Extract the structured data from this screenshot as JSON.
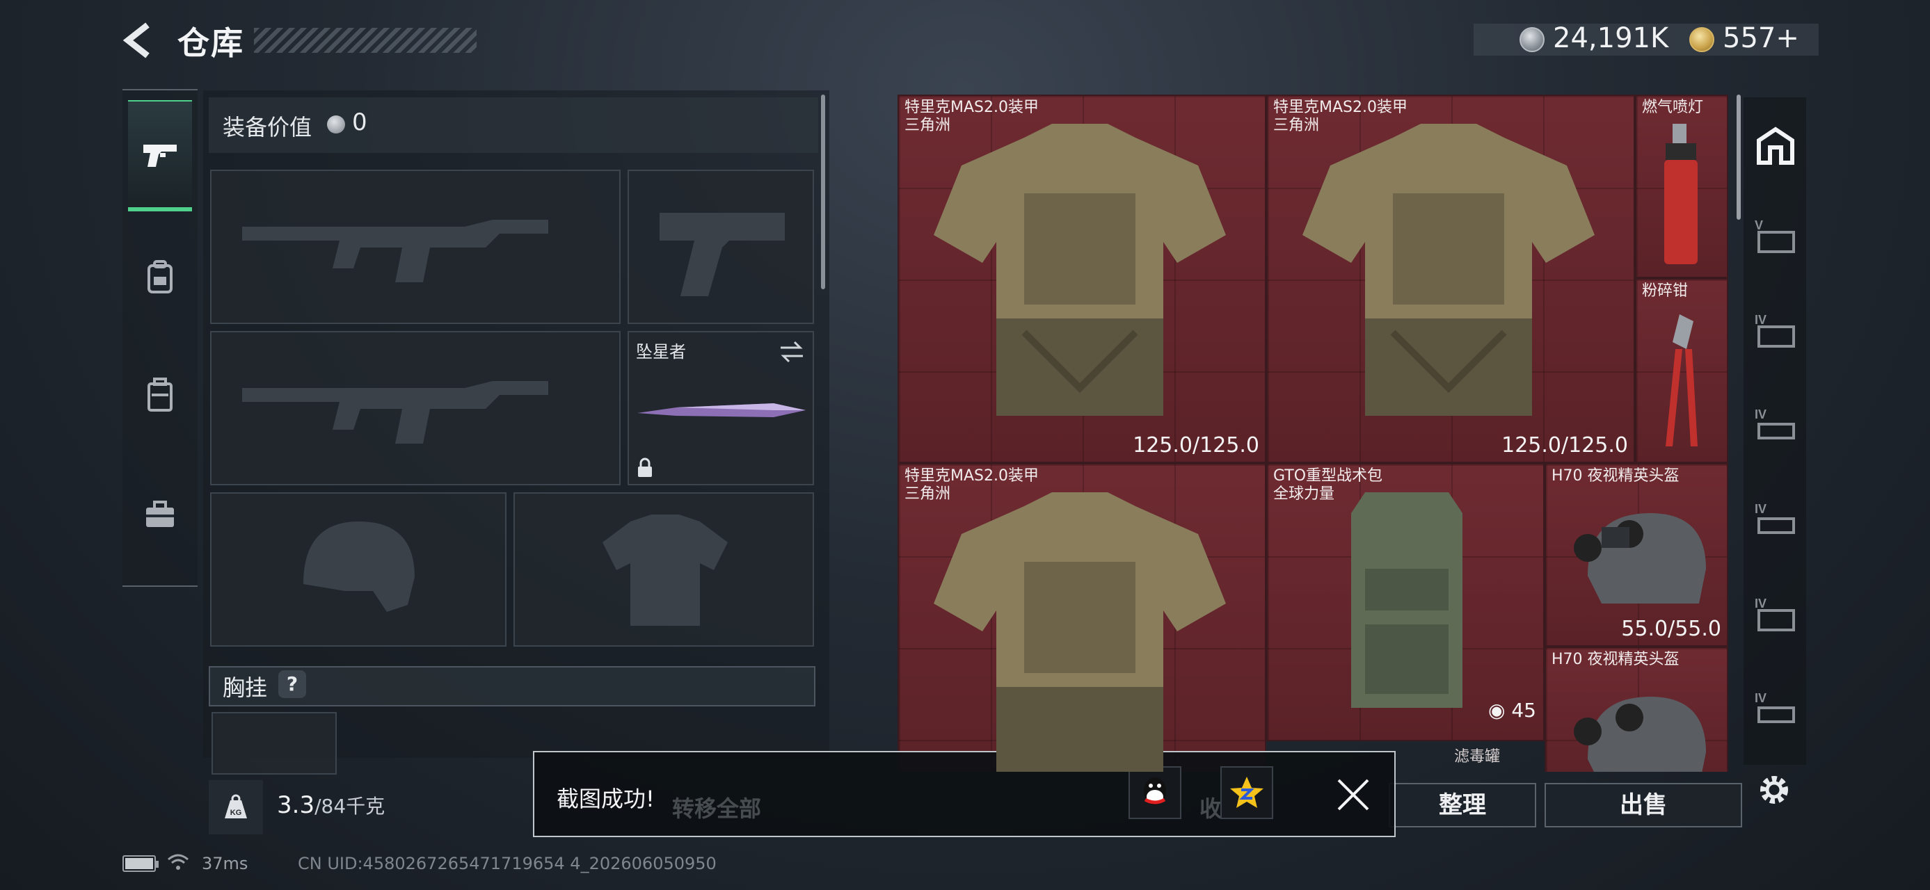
{
  "header": {
    "title": "仓库",
    "silver_value": "24,191K",
    "gold_value": "557",
    "gold_plus": "+"
  },
  "left_nav": {
    "items": [
      {
        "name": "weapons",
        "icon": "pistol-icon",
        "active": true
      },
      {
        "name": "equipment",
        "icon": "backpack-icon",
        "active": false
      },
      {
        "name": "gear",
        "icon": "case-icon",
        "active": false
      },
      {
        "name": "tools",
        "icon": "toolbox-icon",
        "active": false
      }
    ]
  },
  "loadout": {
    "equip_value_label": "装备价值",
    "equip_value": "0",
    "melee_slot_name": "坠星者",
    "chest_label": "胸挂",
    "chest_help": "?",
    "weight_current": "3.3",
    "weight_max": "/84千克",
    "weight_icon_label": "KG"
  },
  "storage": {
    "items": [
      {
        "name_line1": "特里克MAS2.0装甲",
        "name_line2": "三角洲",
        "durability": "125.0/125.0"
      },
      {
        "name_line1": "特里克MAS2.0装甲",
        "name_line2": "三角洲",
        "durability": "125.0/125.0"
      },
      {
        "name_line1": "燃气喷灯",
        "name_line2": ""
      },
      {
        "name_line1": "粉碎钳",
        "name_line2": ""
      },
      {
        "name_line1": "特里克MAS2.0装甲",
        "name_line2": "三角洲",
        "durability": ""
      },
      {
        "name_line1": "GTO重型战术包",
        "name_line2": "全球力量",
        "count": "45"
      },
      {
        "name_line1": "H70 夜视精英头盔",
        "name_line2": "",
        "durability": "55.0/55.0"
      },
      {
        "name_line1": "H70 夜视精英头盔",
        "name_line2": ""
      }
    ],
    "partial_label": "滤毒罐"
  },
  "right_nav": {
    "items": [
      "home-icon",
      "tier-v-icon",
      "tier-iv-icon",
      "tier-iv-icon",
      "tier-iv-icon",
      "tier-iv-icon",
      "tier-iv-icon"
    ],
    "tier_labels": [
      "V",
      "IV",
      "IV",
      "IV",
      "IV",
      "IV"
    ]
  },
  "actions": {
    "sort_label": "整理",
    "sell_label": "出售"
  },
  "toast": {
    "message": "截图成功!",
    "under_text_1": "转移全部",
    "under_text_2": "收藏箱"
  },
  "footer": {
    "ping": "37ms",
    "uid": "CN UID:4580267265471719654 4_202606050950"
  },
  "colors": {
    "accent_green": "#4fd18c",
    "storage_red": "#6e2a31"
  }
}
